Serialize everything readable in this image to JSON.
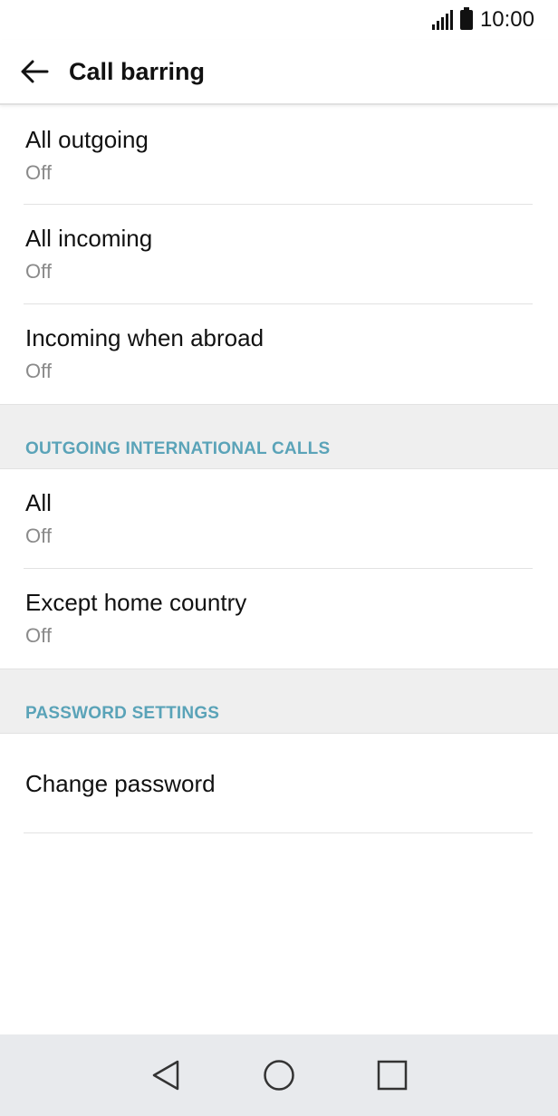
{
  "status_bar": {
    "time": "10:00"
  },
  "app_bar": {
    "title": "Call barring"
  },
  "group_main": [
    {
      "title": "All outgoing",
      "subtitle": "Off"
    },
    {
      "title": "All incoming",
      "subtitle": "Off"
    },
    {
      "title": "Incoming when abroad",
      "subtitle": "Off"
    }
  ],
  "section_international": {
    "header": "OUTGOING INTERNATIONAL CALLS",
    "items": [
      {
        "title": "All",
        "subtitle": "Off"
      },
      {
        "title": "Except home country",
        "subtitle": "Off"
      }
    ]
  },
  "section_password": {
    "header": "PASSWORD SETTINGS",
    "items": [
      {
        "title": "Change password"
      }
    ]
  },
  "colors": {
    "accent": "#5aa3b8",
    "subtitle": "#8a8a8a",
    "section_bg": "#efefef",
    "nav_bg": "#e8eaed"
  }
}
